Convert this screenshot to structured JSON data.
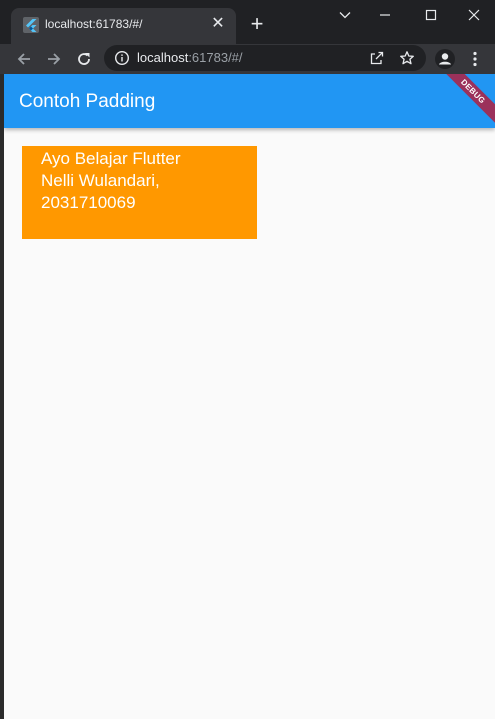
{
  "browser": {
    "tab": {
      "title": "localhost:61783/#/",
      "favicon_icon": "flutter-icon",
      "close_symbol": "✕"
    },
    "new_tab_symbol": "+",
    "window_controls": {
      "tabsearch_icon": "chevron-down-icon",
      "minimize_icon": "minimize-icon",
      "maximize_icon": "maximize-icon",
      "close_icon": "close-icon"
    },
    "toolbar": {
      "back_icon": "arrow-left-icon",
      "forward_icon": "arrow-right-icon",
      "reload_icon": "reload-icon",
      "url_host": "localhost",
      "url_rest": ":61783/#/",
      "share_icon": "share-icon",
      "bookmark_icon": "star-icon",
      "profile_icon": "person-icon",
      "menu_icon": "more-vert-icon"
    },
    "colors": {
      "frame": "#202124",
      "toolbar": "#35363a"
    }
  },
  "app": {
    "appbar": {
      "title": "Contoh Padding",
      "color": "#2196f3"
    },
    "debug_banner": "DEBUG",
    "content": {
      "box_color": "#ff9800",
      "lines": [
        "Ayo Belajar Flutter",
        "Nelli Wulandari,",
        "2031710069"
      ]
    },
    "background": "#fafafa"
  }
}
